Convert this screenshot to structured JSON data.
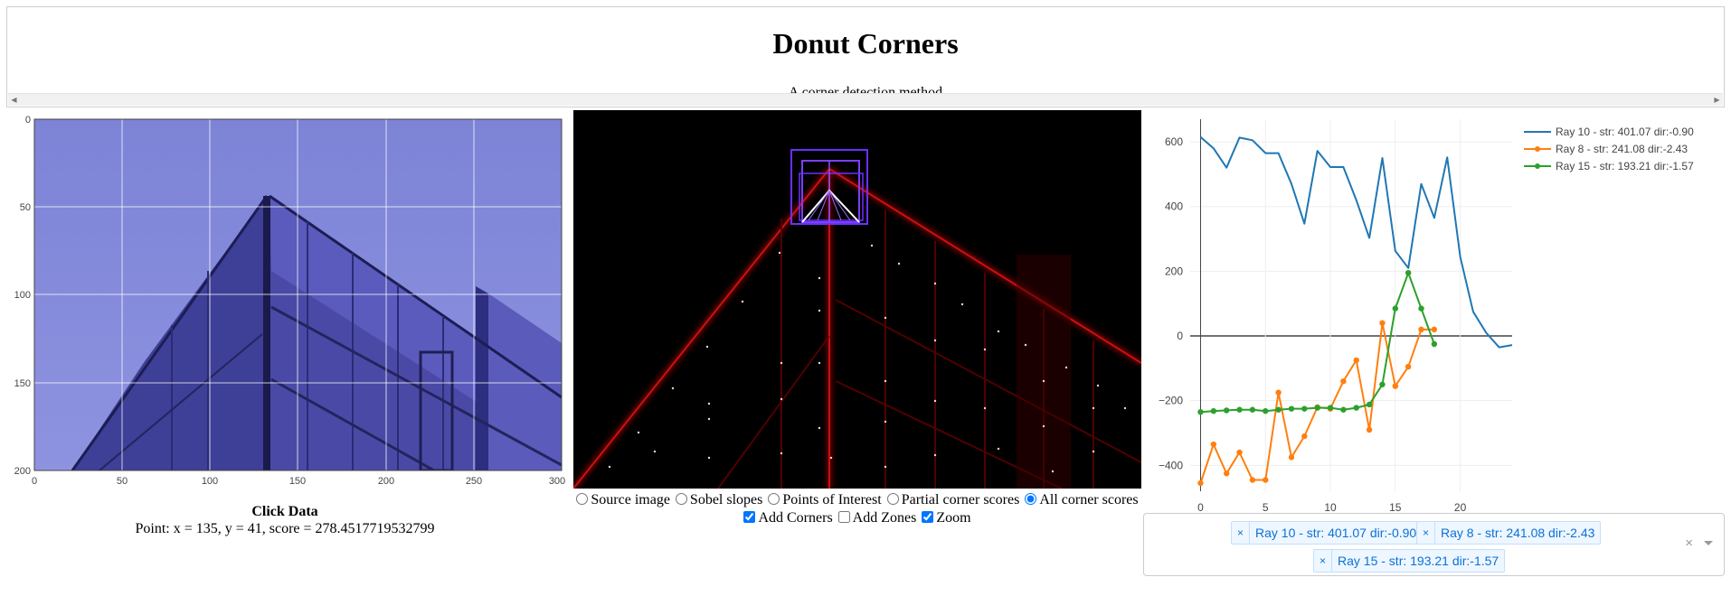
{
  "header": {
    "title": "Donut Corners",
    "subtitle": "A corner detection method"
  },
  "left_plot": {
    "x_ticks": [
      "0",
      "50",
      "100",
      "150",
      "200",
      "250",
      "300"
    ],
    "y_ticks": [
      "0",
      "50",
      "100",
      "150",
      "200"
    ]
  },
  "click_data": {
    "title": "Click Data",
    "point_text": "Point: x = 135, y = 41, score = 278.4517719532799"
  },
  "view_modes": [
    {
      "label": "Source image",
      "checked": false
    },
    {
      "label": "Sobel slopes",
      "checked": false
    },
    {
      "label": "Points of Interest",
      "checked": false
    },
    {
      "label": "Partial corner scores",
      "checked": false
    },
    {
      "label": "All corner scores",
      "checked": true
    }
  ],
  "options": [
    {
      "label": "Add Corners",
      "checked": true
    },
    {
      "label": "Add Zones",
      "checked": false
    },
    {
      "label": "Zoom",
      "checked": true
    }
  ],
  "chart_data": {
    "type": "line",
    "x_ticks": [
      "0",
      "5",
      "10",
      "15",
      "20"
    ],
    "y_ticks": [
      "600",
      "400",
      "200",
      "0",
      "−200",
      "−400"
    ],
    "xlim": [
      -0.8,
      24
    ],
    "ylim": [
      -480,
      670
    ],
    "grid": true,
    "legend_position": "top-right",
    "series": [
      {
        "name": "Ray 10 - str: 401.07 dir:-0.90",
        "color": "#1f77b4",
        "markers": false,
        "x": [
          0,
          1,
          2,
          3,
          4,
          5,
          6,
          7,
          8,
          9,
          10,
          11,
          12,
          13,
          14,
          15,
          16,
          17,
          18,
          19,
          20,
          21,
          22,
          23,
          24
        ],
        "y": [
          615,
          580,
          520,
          613,
          605,
          565,
          565,
          470,
          347,
          572,
          522,
          522,
          420,
          303,
          550,
          263,
          210,
          470,
          365,
          552,
          245,
          75,
          10,
          -35,
          -28
        ]
      },
      {
        "name": "Ray 8 - str: 241.08 dir:-2.43",
        "color": "#ff7f0e",
        "markers": true,
        "x": [
          0,
          1,
          2,
          3,
          4,
          5,
          6,
          7,
          8,
          9,
          10,
          11,
          12,
          13,
          14,
          15,
          16,
          17,
          18
        ],
        "y": [
          -455,
          -335,
          -425,
          -360,
          -445,
          -445,
          -175,
          -375,
          -310,
          -220,
          -225,
          -140,
          -75,
          -290,
          40,
          -155,
          -95,
          20,
          20
        ]
      },
      {
        "name": "Ray 15 - str: 193.21 dir:-1.57",
        "color": "#2ca02c",
        "markers": true,
        "x": [
          0,
          1,
          2,
          3,
          4,
          5,
          6,
          7,
          8,
          9,
          10,
          11,
          12,
          13,
          14,
          15,
          16,
          17,
          18
        ],
        "y": [
          -235,
          -232,
          -230,
          -228,
          -228,
          -232,
          -228,
          -225,
          -225,
          -222,
          -222,
          -228,
          -222,
          -212,
          -150,
          85,
          195,
          85,
          -25
        ]
      }
    ]
  },
  "selected_rays": [
    {
      "remove": "×",
      "label": "Ray 10 - str: 401.07 dir:-0.90"
    },
    {
      "remove": "×",
      "label": "Ray 8 - str: 241.08 dir:-2.43"
    },
    {
      "remove": "×",
      "label": "Ray 15 - str: 193.21 dir:-1.57"
    }
  ],
  "multiselect": {
    "clear": "×"
  }
}
